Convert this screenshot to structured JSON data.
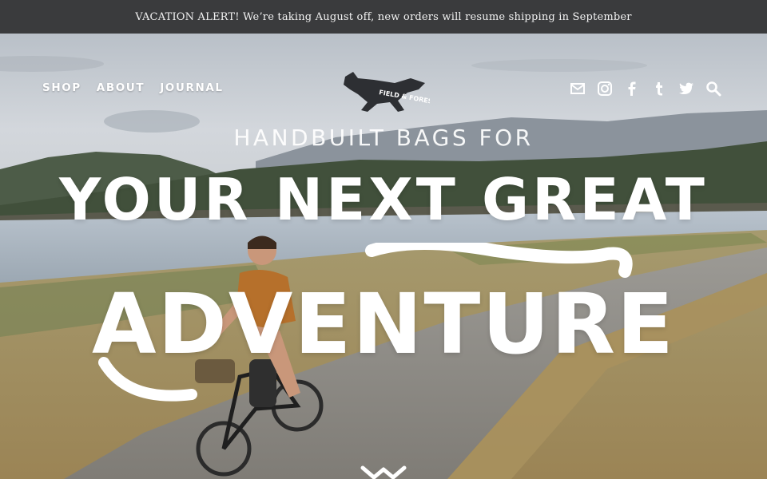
{
  "announcement": {
    "text": "VACATION ALERT! We’re taking August off, new orders will resume shipping in September"
  },
  "nav": {
    "left": [
      {
        "label": "SHOP"
      },
      {
        "label": "ABOUT"
      },
      {
        "label": "JOURNAL"
      }
    ],
    "right_icons": [
      "mail-icon",
      "instagram-icon",
      "facebook-icon",
      "tumblr-icon",
      "twitter-icon",
      "search-icon"
    ]
  },
  "logo": {
    "text": "FIELD & FOREST",
    "mark": "fox-logo"
  },
  "hero": {
    "tagline": "HANDBUILT BAGS FOR",
    "headline_line1": "YOUR NEXT GREAT",
    "headline_line2": "ADVENTURE"
  },
  "colors": {
    "announcement_bg": "#3a3b3d",
    "text_white": "#ffffff",
    "sky": "#c5cbd2",
    "water": "#aeb8c2",
    "grass": "#b9a173",
    "road": "#8f8d88"
  }
}
